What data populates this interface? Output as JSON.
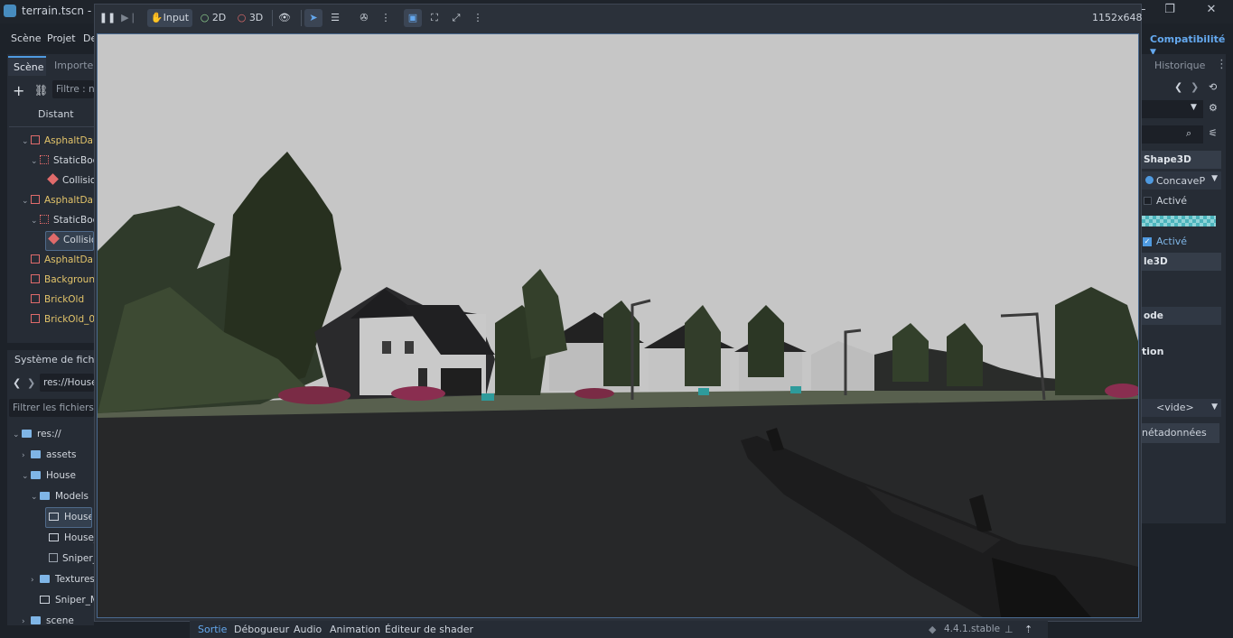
{
  "window": {
    "title": "terrain.tscn - je",
    "controls": [
      "minimize-icon",
      "maximize-icon",
      "close-icon"
    ]
  },
  "menu": {
    "scene": "Scène",
    "project": "Projet",
    "debug": "De"
  },
  "renderer": "Compatibilité",
  "scene_dock": {
    "tabs": [
      "Scène",
      "Importer"
    ],
    "filter_placeholder": "Filtre : n",
    "remote_label": "Distant",
    "nodes": [
      {
        "label": "AsphaltDar",
        "kind": "mesh",
        "depth": 1
      },
      {
        "label": "StaticBoc",
        "kind": "body",
        "depth": 2
      },
      {
        "label": "Collisio",
        "kind": "shape",
        "depth": 3
      },
      {
        "label": "AsphaltDar",
        "kind": "mesh",
        "depth": 1
      },
      {
        "label": "StaticBoc",
        "kind": "body",
        "depth": 2
      },
      {
        "label": "Collisio",
        "kind": "shape",
        "depth": 3,
        "selected": true
      },
      {
        "label": "AsphaltDar",
        "kind": "mesh",
        "depth": 1
      },
      {
        "label": "Backgroun",
        "kind": "mesh",
        "depth": 1
      },
      {
        "label": "BrickOld",
        "kind": "mesh",
        "depth": 1
      },
      {
        "label": "BrickOld_0",
        "kind": "mesh",
        "depth": 1
      }
    ]
  },
  "filesystem_dock": {
    "title": "Système de fichier",
    "path": "res://House",
    "filter_placeholder": "Filtrer les fichiers",
    "items": [
      {
        "label": "res://",
        "kind": "folder",
        "depth": 0
      },
      {
        "label": "assets",
        "kind": "folder",
        "depth": 1
      },
      {
        "label": "House",
        "kind": "folder",
        "depth": 1
      },
      {
        "label": "Models",
        "kind": "folder",
        "depth": 2
      },
      {
        "label": "House.",
        "kind": "scene",
        "depth": 3,
        "selected": true
      },
      {
        "label": "House_",
        "kind": "scene",
        "depth": 3
      },
      {
        "label": "Sniper_",
        "kind": "mesh",
        "depth": 3
      },
      {
        "label": "Textures",
        "kind": "folder",
        "depth": 2
      },
      {
        "label": "Sniper_M",
        "kind": "scene",
        "depth": 2
      },
      {
        "label": "scene",
        "kind": "folder",
        "depth": 1
      }
    ]
  },
  "inspector": {
    "history_tab": "Historique",
    "shape_header": "Shape3D",
    "shape_value": "ConcaveP",
    "active_label_1": "Activé",
    "active_label_2": "Activé",
    "section_1": "le3D",
    "section_2": "ode",
    "section_3": "tion",
    "empty_value": "<vide>",
    "metadata_button": "nétadonnées"
  },
  "game_window": {
    "resolution": "1152x648",
    "input_label": "Input",
    "mode_2d": "2D",
    "mode_3d": "3D"
  },
  "bottom_panel": {
    "tabs": [
      "Sortie",
      "Débogueur",
      "Audio",
      "Animation",
      "Éditeur de shader"
    ],
    "version": "4.4.1.stable"
  },
  "colors": {
    "accent": "#4f9ae0",
    "sky": "#c7c7c7",
    "road": "#262729",
    "node_yellow": "#e3c46a"
  }
}
